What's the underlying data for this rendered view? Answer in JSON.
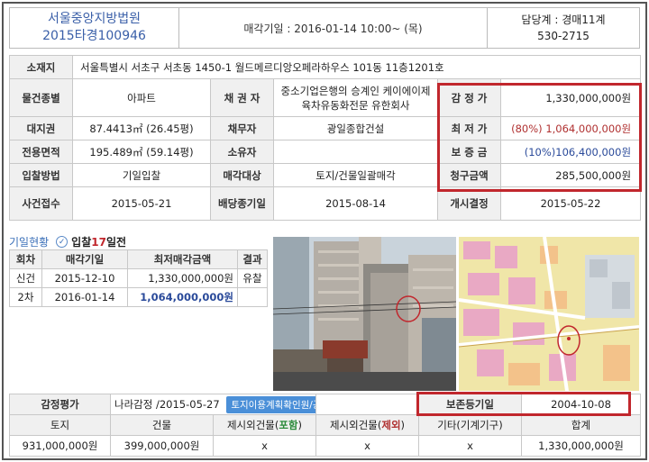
{
  "header": {
    "court": "서울중앙지방법원",
    "case_no": "2015타경100946",
    "sale_date": "매각기일 : 2016-01-14   10:00~ (목)",
    "dept": "담당계 : 경매11계",
    "phone": "530-2715"
  },
  "info": {
    "location_label": "소재지",
    "location": "서울특별시 서초구 서초동 1450-1 월드메르디앙오페라하우스 101동 11층1201호",
    "type_label": "물건종별",
    "type": "아파트",
    "creditor_label": "채 권 자",
    "creditor": "중소기업은행의 승계인 케이에이제육차유동화전문 유한회사",
    "appraisal_label": "감 정 가",
    "appraisal": "1,330,000,000원",
    "land_label": "대지권",
    "land": "87.4413㎡ (26.45평)",
    "debtor_label": "채무자",
    "debtor": "광일종합건설",
    "minimum_label": "최 저 가",
    "minimum": "(80%) 1,064,000,000원",
    "area_label": "전용면적",
    "area": "195.489㎡ (59.14평)",
    "owner_label": "소유자",
    "owner": "",
    "deposit_label": "보 증 금",
    "deposit": "(10%)106,400,000원",
    "method_label": "입찰방법",
    "method": "기일입찰",
    "target_label": "매각대상",
    "target": "토지/건물일괄매각",
    "claim_label": "청구금액",
    "claim": "285,500,000원",
    "received_label": "사건접수",
    "received": "2015-05-21",
    "dividend_label": "배당종기일",
    "dividend": "2015-08-14",
    "decision_label": "개시결정",
    "decision": "2015-05-22"
  },
  "history": {
    "title": "기일현황",
    "check_icon": "check-circle-icon",
    "remaining_prefix": "입찰",
    "remaining_num": "17",
    "remaining_suffix": "일전",
    "columns": [
      "회차",
      "매각기일",
      "최저매각금액",
      "결과"
    ],
    "rows": [
      {
        "round": "신건",
        "date": "2015-12-10",
        "price": "1,330,000,000원",
        "result": "유찰"
      },
      {
        "round": "2차",
        "date": "2016-01-14",
        "price": "1,064,000,000원",
        "result": ""
      }
    ]
  },
  "appraisal_detail": {
    "label": "감정평가",
    "agency": "나라감정 /2015-05-27",
    "link": "토지이용계획확인원/공시지가",
    "priority_label": "보존등기일",
    "priority_date": "2004-10-08",
    "columns": {
      "land": "토지",
      "building": "건물",
      "extra_inc_prefix": "제시외건물(",
      "extra_inc_word": "포함",
      "extra_exc_prefix": "제시외건물(",
      "extra_exc_word": "제외",
      "close": ")",
      "other": "기타(기계기구)",
      "total": "합계"
    },
    "values": {
      "land": "931,000,000원",
      "building": "399,000,000원",
      "extra_inc": "x",
      "extra_exc": "x",
      "other": "x",
      "total": "1,330,000,000원"
    }
  },
  "colors": {
    "highlight": "#c1272d",
    "link": "#4a8fd8",
    "court_text": "#3a5fa8"
  }
}
